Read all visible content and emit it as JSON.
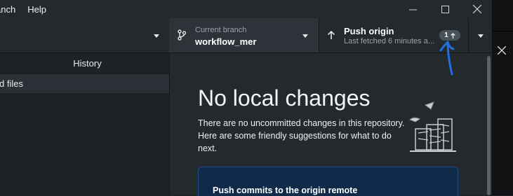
{
  "menus": [
    "anch",
    "Help"
  ],
  "window_controls": [
    "minimize-icon",
    "maximize-icon",
    "close-icon"
  ],
  "toolbar": {
    "current_branch_label": "Current branch",
    "current_branch_value": "workflow_mer",
    "push_title": "Push origin",
    "push_subtitle": "Last fetched 6 minutes a...",
    "push_badge": "1"
  },
  "sidebar": {
    "tab_history": "History",
    "changed_files_label": "d files"
  },
  "main": {
    "headline": "No local changes",
    "description": "There are no uncommitted changes in this repository. Here are some friendly suggestions for what to do next.",
    "card_title": "Push commits to the origin remote"
  },
  "colors": {
    "background": "#24292e",
    "card_bg": "#102a4a",
    "annotation_stroke": "#1f6fe0"
  }
}
